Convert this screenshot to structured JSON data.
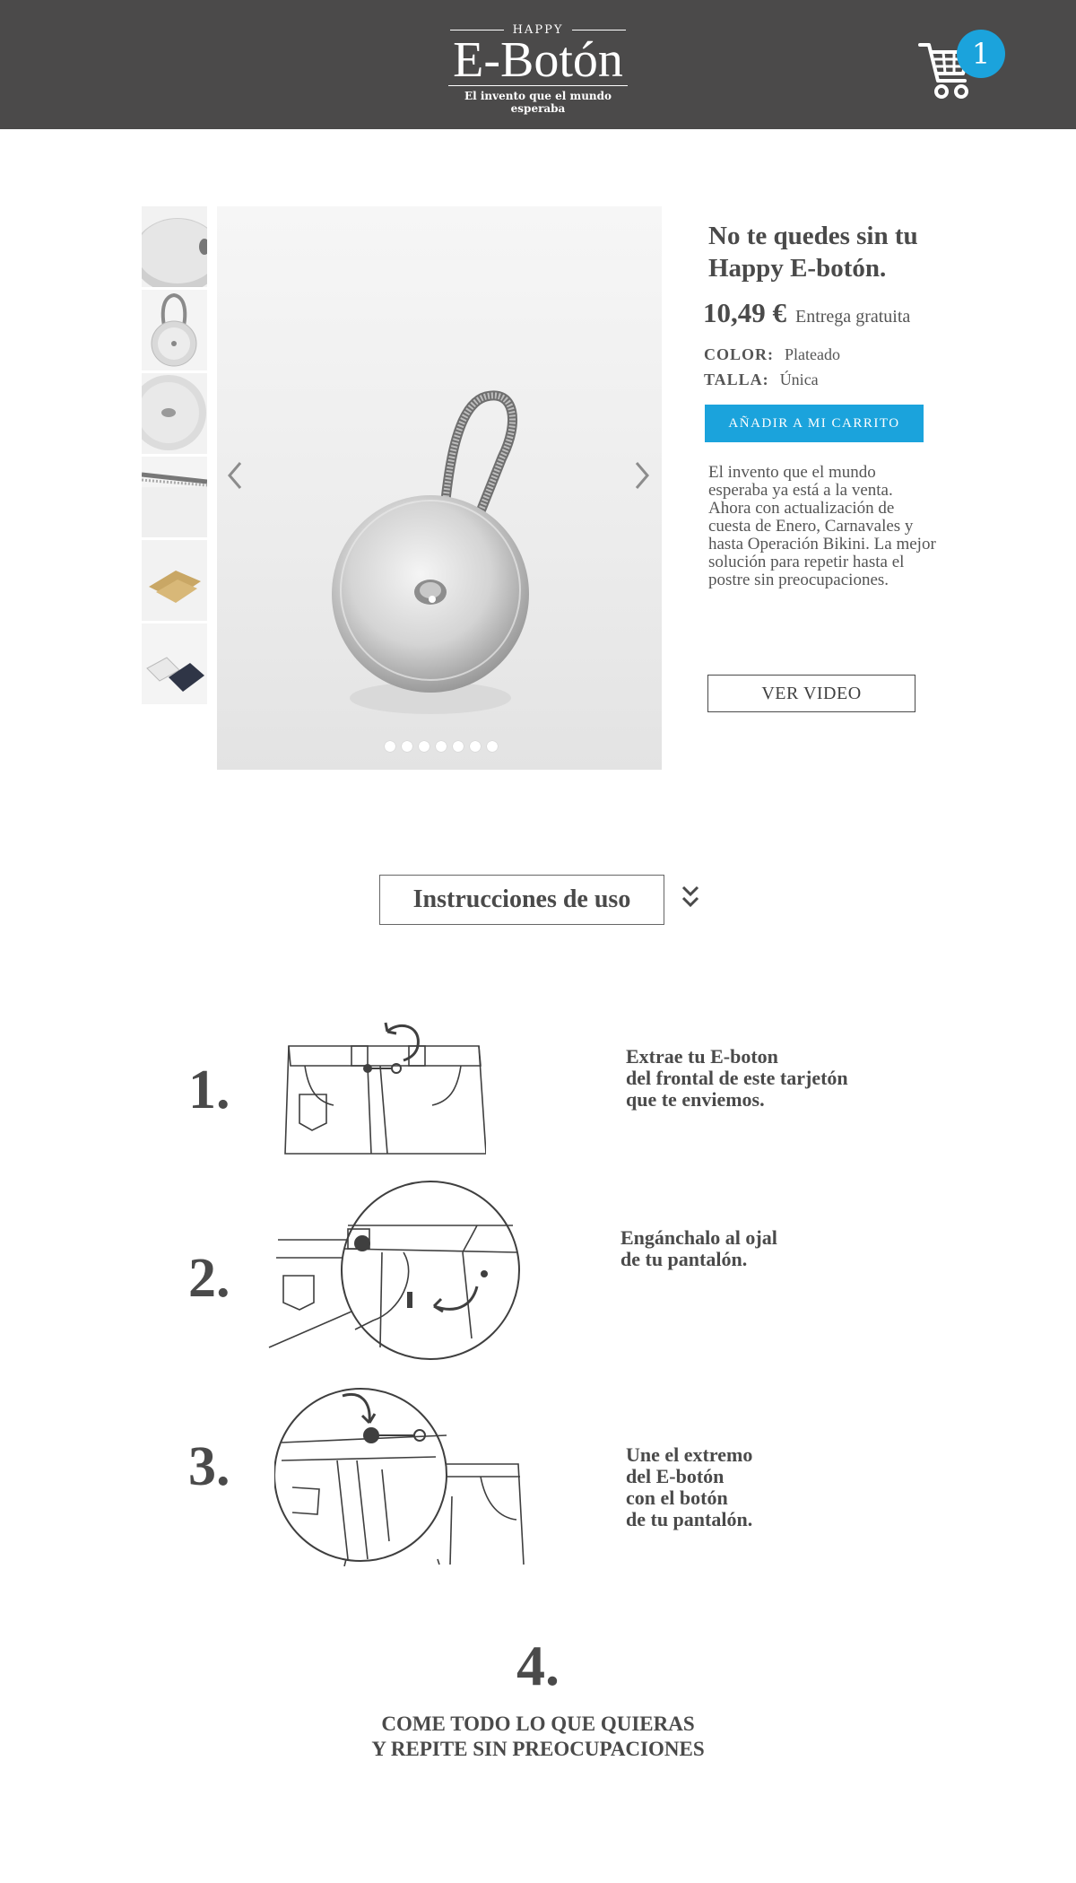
{
  "header": {
    "logo_small": "HAPPY",
    "logo_main": "E-Botón",
    "logo_tagline": "El invento que el mundo esperaba",
    "cart_count": "1",
    "cart_icon": "shopping-cart-icon",
    "bg_color": "#4b4a4a",
    "accent_color": "#1ba3dc"
  },
  "gallery": {
    "thumbnails": [
      "button-closeup",
      "button-with-loop",
      "button-top",
      "spring-detail",
      "kraft-card",
      "cards-pair"
    ],
    "dot_count": 7,
    "prev_icon": "chevron-left-icon",
    "next_icon": "chevron-right-icon"
  },
  "product": {
    "title": "No te quedes sin tu Happy E-botón.",
    "price": "10,49 €",
    "delivery": "Entrega gratuita",
    "color_label": "COLOR:",
    "color_value": "Plateado",
    "size_label": "TALLA:",
    "size_value": "Única",
    "add_button": "AÑADIR A MI CARRITO",
    "description": "El invento que el mundo esperaba ya está a la venta. Ahora con actualización de cuesta de Enero, Carnavales y hasta Operación Bikini. La mejor solución para repetir hasta el postre sin preocupaciones.",
    "video_button": "VER VIDEO"
  },
  "instructions": {
    "heading": "Instrucciones de uso",
    "toggle_icon": "double-chevron-down-icon",
    "steps": [
      {
        "num": "1.",
        "text_lines": [
          "Extrae tu E-boton",
          "del frontal de este tarjetón",
          "que te enviemos."
        ]
      },
      {
        "num": "2.",
        "text_lines": [
          "Engánchalo al ojal",
          "de tu pantalón."
        ]
      },
      {
        "num": "3.",
        "text_lines": [
          "Une el extremo",
          "del E-botón",
          "con el botón",
          "de tu pantalón."
        ]
      }
    ],
    "final_num": "4.",
    "final_lines": [
      "COME TODO LO QUE QUIERAS",
      "Y REPITE SIN PREOCUPACIONES"
    ]
  }
}
